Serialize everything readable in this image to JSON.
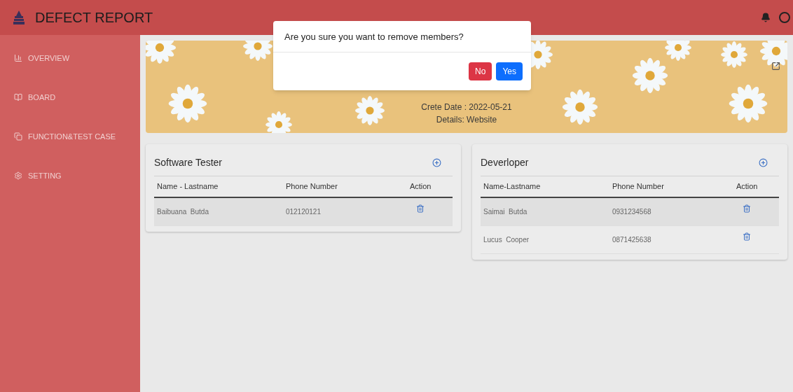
{
  "header": {
    "title": "DEFECT REPORT"
  },
  "sidebar": {
    "items": [
      {
        "label": "OVERVIEW"
      },
      {
        "label": "BOARD"
      },
      {
        "label": "FUNCTION&TEST CASE"
      },
      {
        "label": "SETTING"
      }
    ]
  },
  "banner": {
    "create_date": "Crete Date : 2022-05-21",
    "details": "Details: Website"
  },
  "teams": [
    {
      "title": "Software Tester",
      "columns": [
        "Name - Lastname",
        "Phone Number",
        "Action"
      ],
      "rows": [
        {
          "name": "Baibuana  Butda",
          "phone": "012120121"
        }
      ]
    },
    {
      "title": "Deverloper",
      "columns": [
        "Name-Lastname",
        "Phone Number",
        "Action"
      ],
      "rows": [
        {
          "name": "Saimai  Butda",
          "phone": "0931234568"
        },
        {
          "name": "Lucus  Cooper",
          "phone": "0871425638"
        }
      ]
    }
  ],
  "dialog": {
    "message": "Are you sure you want to remove members?",
    "buttons": [
      {
        "label": "No",
        "kind": "danger"
      },
      {
        "label": "Yes",
        "kind": "primary"
      }
    ]
  }
}
